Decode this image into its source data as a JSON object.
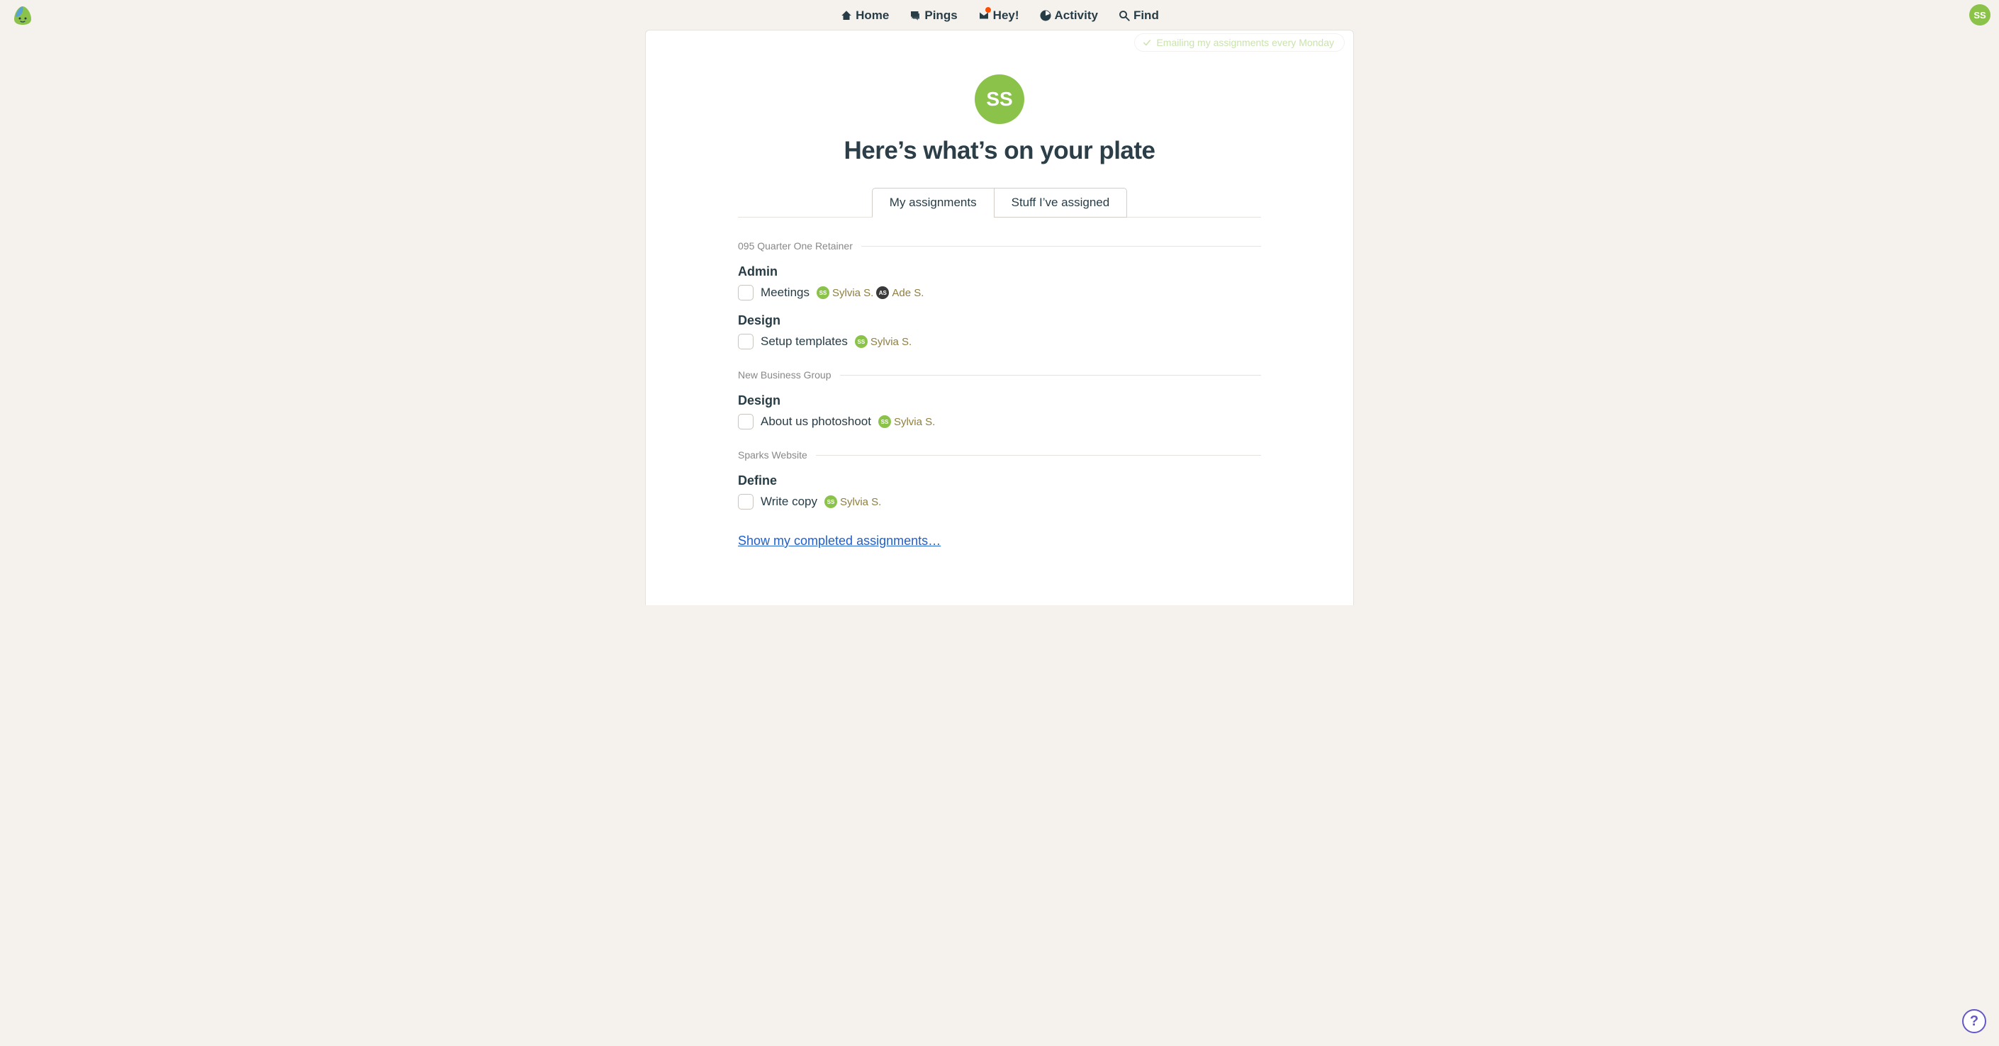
{
  "nav": {
    "home": "Home",
    "pings": "Pings",
    "hey": "Hey!",
    "activity": "Activity",
    "find": "Find"
  },
  "user": {
    "initials": "SS"
  },
  "banner": {
    "text": "Emailing my assignments every Monday"
  },
  "header": {
    "avatar_initials": "SS",
    "title": "Here’s what’s on your plate"
  },
  "tabs": {
    "my_assignments": "My assignments",
    "stuff_assigned": "Stuff I’ve assigned"
  },
  "projects": [
    {
      "name": "095 Quarter One Retainer",
      "lists": [
        {
          "title": "Admin",
          "todos": [
            {
              "title": "Meetings",
              "assignees": [
                {
                  "initials": "SS",
                  "name": "Sylvia S.",
                  "color": "green"
                },
                {
                  "initials": "AS",
                  "name": "Ade S.",
                  "color": "dark"
                }
              ]
            }
          ]
        },
        {
          "title": "Design",
          "todos": [
            {
              "title": "Setup templates",
              "assignees": [
                {
                  "initials": "SS",
                  "name": "Sylvia S.",
                  "color": "green"
                }
              ]
            }
          ]
        }
      ]
    },
    {
      "name": "New Business Group",
      "lists": [
        {
          "title": "Design",
          "todos": [
            {
              "title": "About us photoshoot",
              "assignees": [
                {
                  "initials": "SS",
                  "name": "Sylvia S.",
                  "color": "green"
                }
              ]
            }
          ]
        }
      ]
    },
    {
      "name": "Sparks Website",
      "lists": [
        {
          "title": "Define",
          "todos": [
            {
              "title": "Write copy",
              "assignees": [
                {
                  "initials": "SS",
                  "name": "Sylvia S.",
                  "color": "green"
                }
              ]
            }
          ]
        }
      ]
    }
  ],
  "completed_link": "Show my completed assignments…",
  "help": "?"
}
